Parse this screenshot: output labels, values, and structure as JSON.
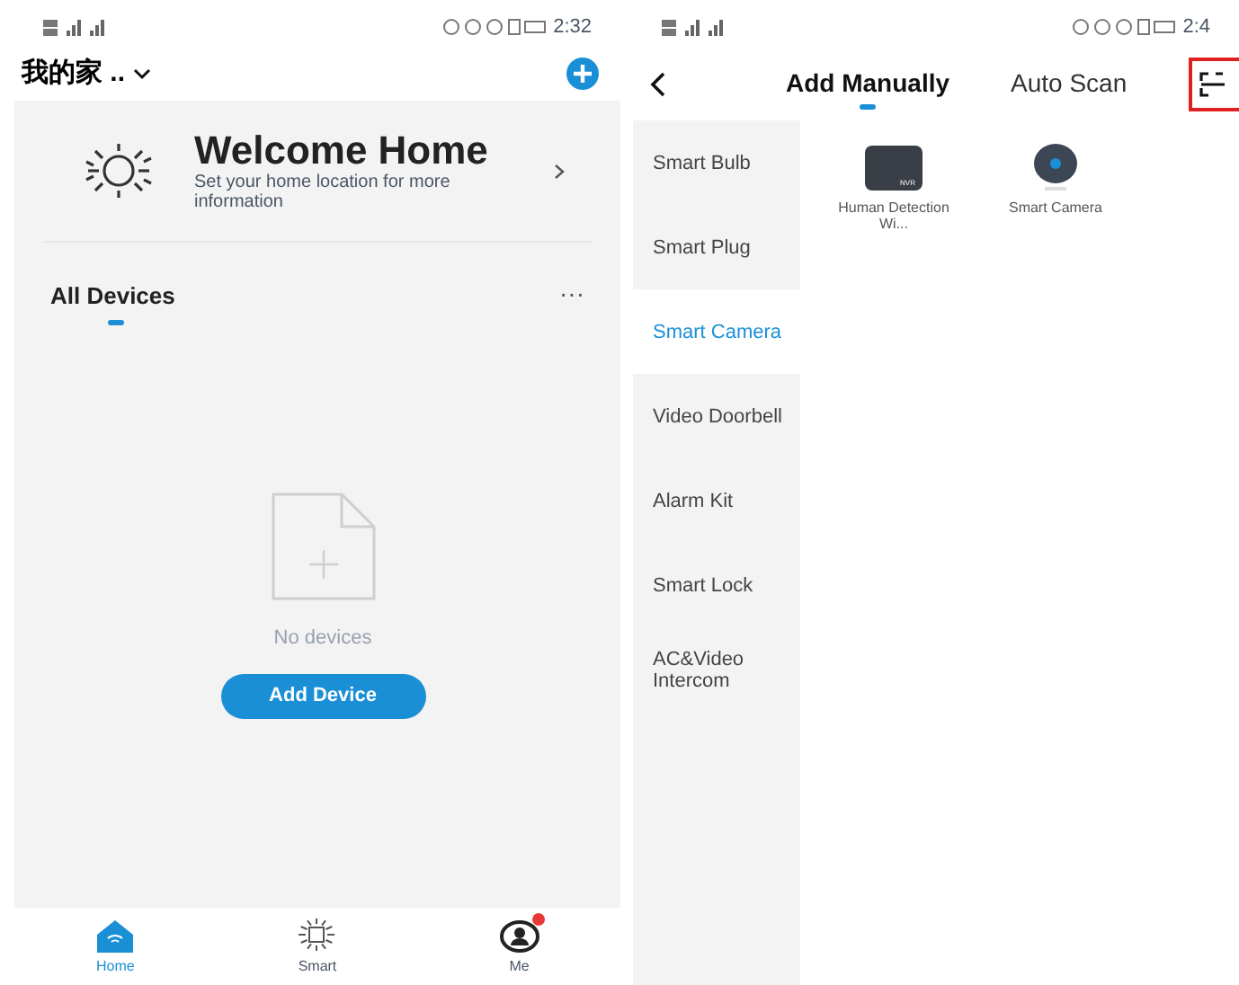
{
  "home_screen": {
    "status_bar": {
      "time": "2:32"
    },
    "home_name": "我的家 ..",
    "welcome": {
      "title": "Welcome Home",
      "subtitle": "Set your home location for more information"
    },
    "section": {
      "title": "All Devices",
      "more": "···"
    },
    "empty_state": {
      "message": "No devices",
      "button": "Add Device"
    },
    "nav": [
      {
        "label": "Home",
        "kind": "home",
        "selected": true,
        "badge": false
      },
      {
        "label": "Smart",
        "kind": "smart",
        "selected": false,
        "badge": false
      },
      {
        "label": "Me",
        "kind": "me",
        "selected": false,
        "badge": true
      }
    ]
  },
  "add_screen": {
    "status_bar": {
      "time": "2:4"
    },
    "tabs": [
      {
        "label": "Add Manually",
        "selected": true
      },
      {
        "label": "Auto Scan",
        "selected": false
      }
    ],
    "categories": [
      {
        "label": "Smart Bulb",
        "selected": false
      },
      {
        "label": "Smart Plug",
        "selected": false
      },
      {
        "label": "Smart Camera",
        "selected": true
      },
      {
        "label": "Video Doorbell",
        "selected": false
      },
      {
        "label": "Alarm Kit",
        "selected": false
      },
      {
        "label": "Smart Lock",
        "selected": false
      },
      {
        "label": "AC&Video Intercom",
        "selected": false
      }
    ],
    "devices": [
      {
        "label": "Human Detection Wi...",
        "kind": "nvr",
        "tag": "NVR"
      },
      {
        "label": "Smart Camera",
        "kind": "camera"
      }
    ]
  }
}
